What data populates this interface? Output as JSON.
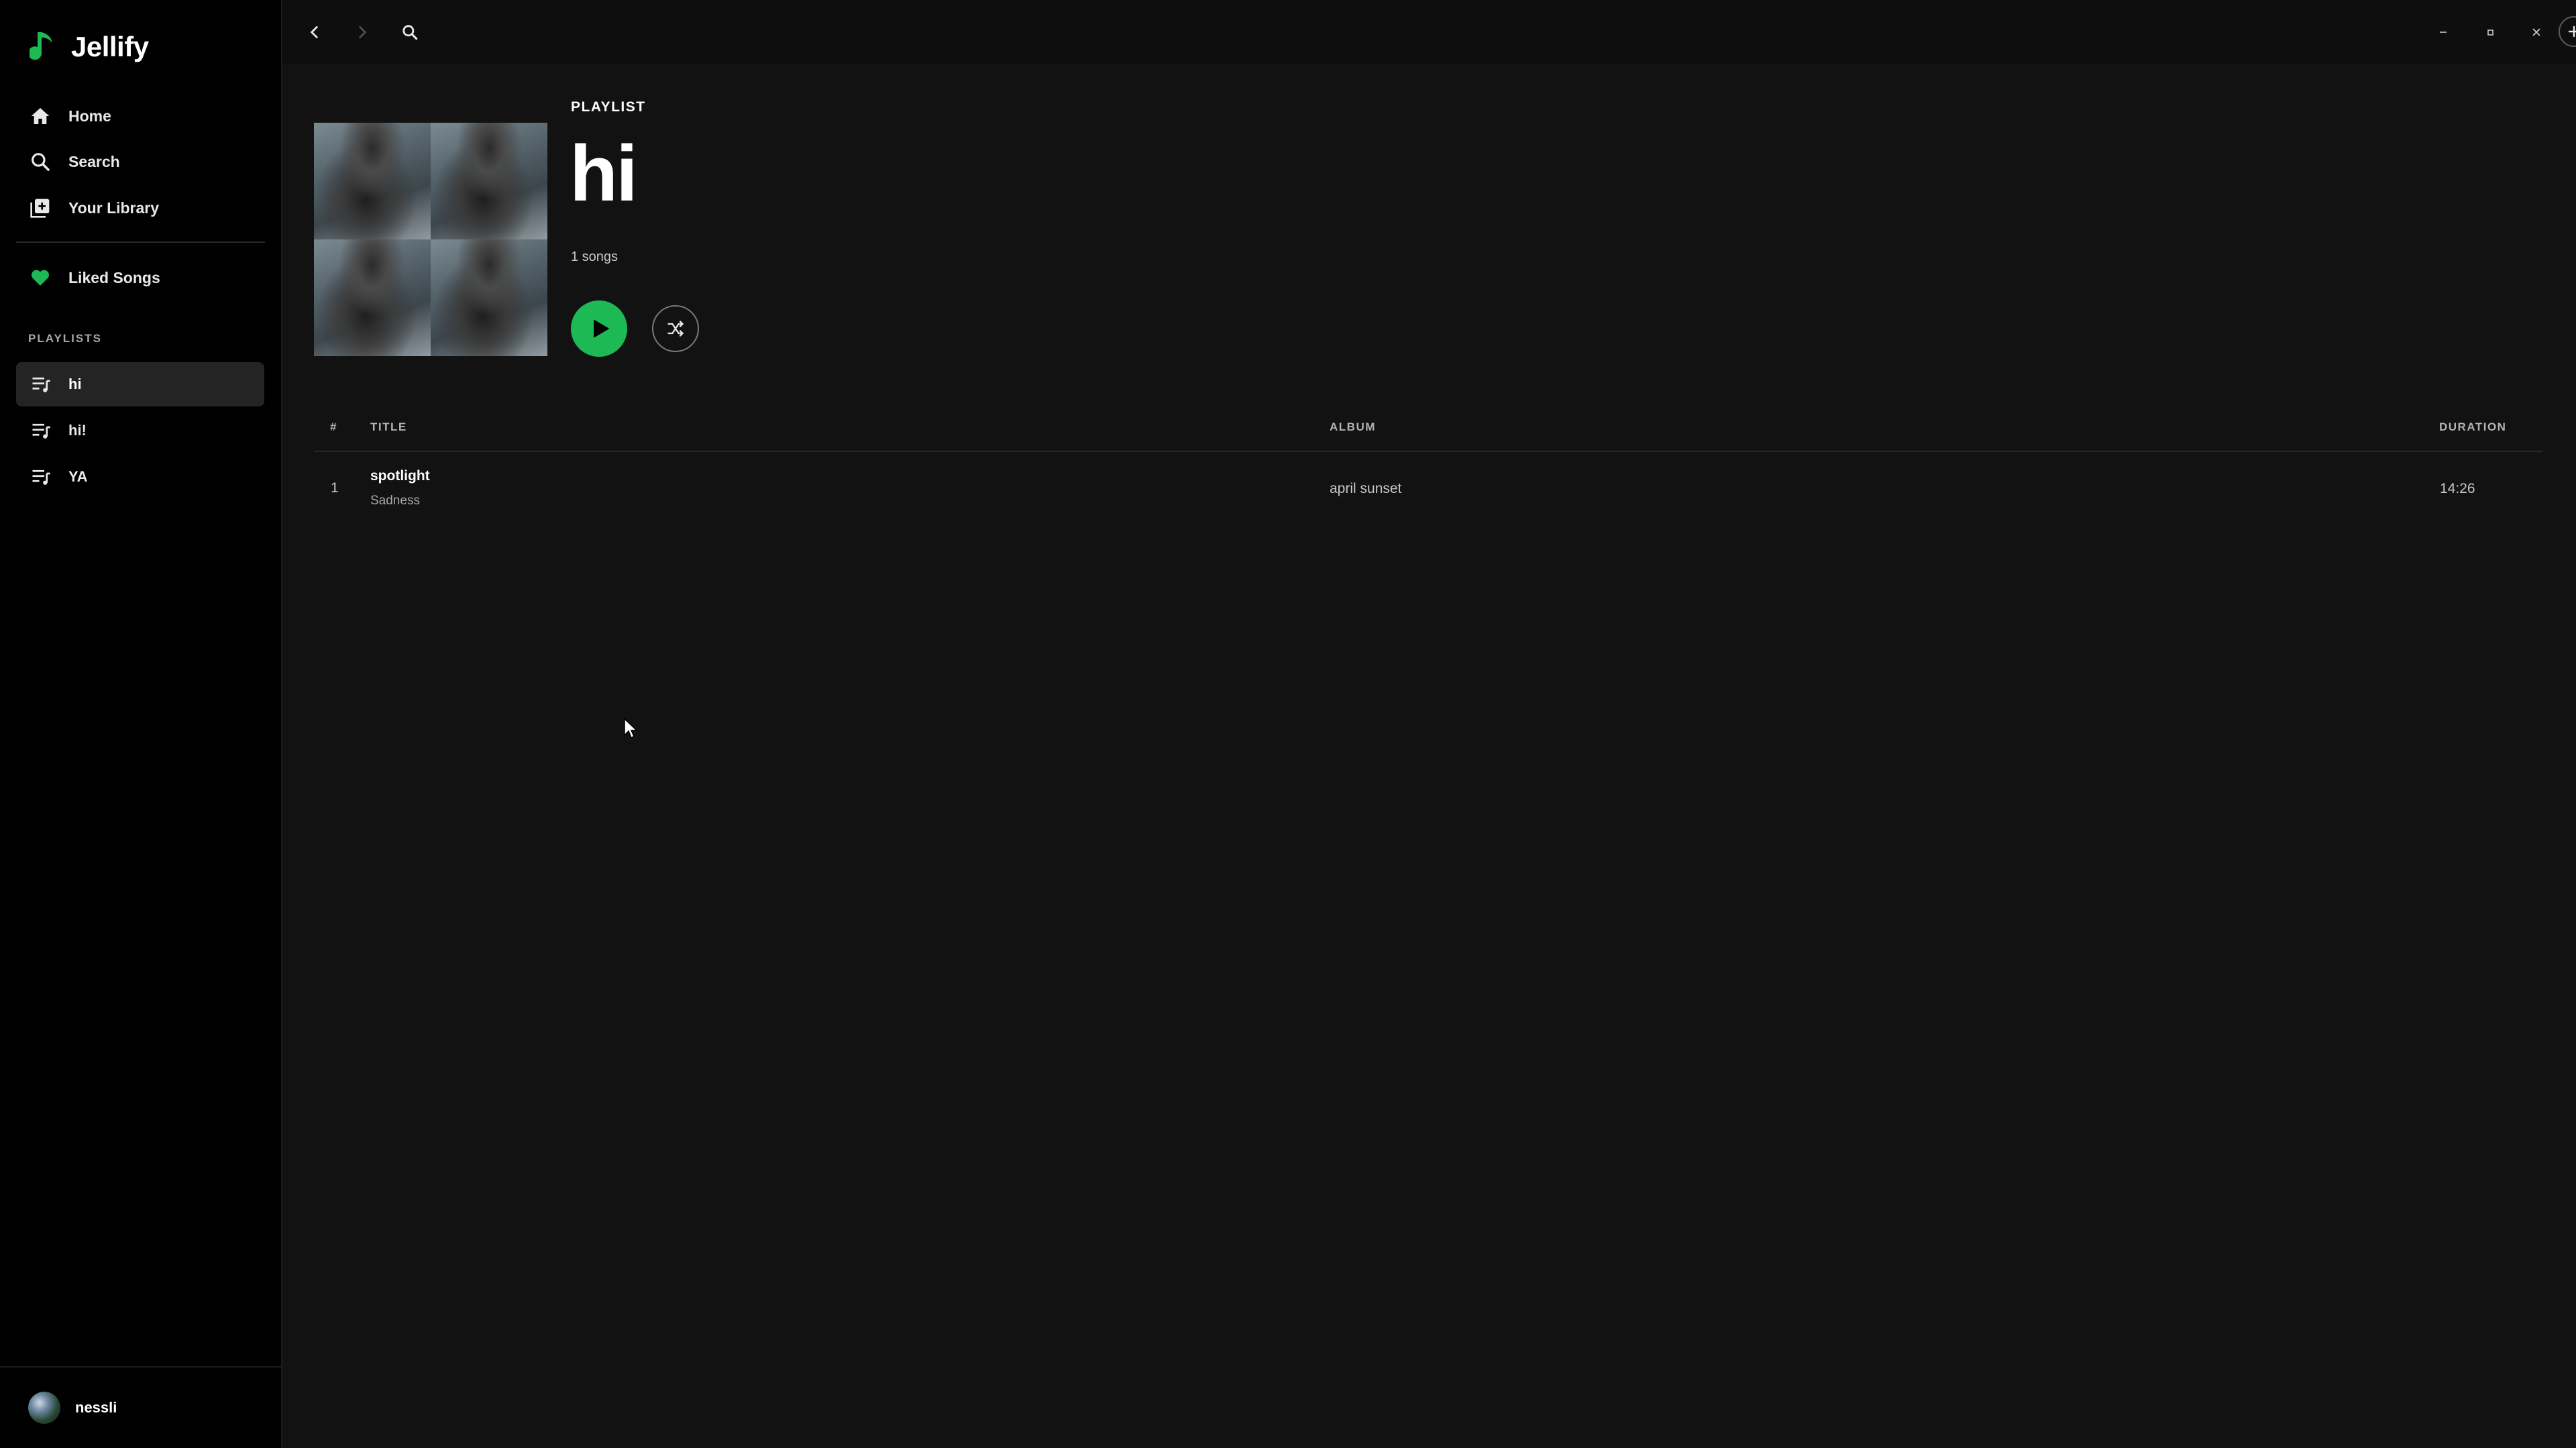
{
  "app": {
    "name": "Jellify"
  },
  "sidebar": {
    "nav": [
      {
        "label": "Home",
        "icon": "home-icon"
      },
      {
        "label": "Search",
        "icon": "search-icon"
      },
      {
        "label": "Your Library",
        "icon": "library-icon"
      }
    ],
    "liked": {
      "label": "Liked Songs",
      "icon": "heart-icon"
    },
    "playlists_label": "PLAYLISTS",
    "playlists": [
      {
        "label": "hi",
        "active": true
      },
      {
        "label": "hi!",
        "active": false
      },
      {
        "label": "YA",
        "active": false
      }
    ],
    "user": {
      "name": "nessli"
    }
  },
  "topbar": {
    "icons": [
      "back-icon",
      "forward-icon",
      "search-icon",
      "add-icon",
      "gear-icon",
      "minimize-icon",
      "maximize-icon",
      "close-icon"
    ]
  },
  "playlist": {
    "type": "PLAYLIST",
    "title": "hi",
    "count": "1 songs"
  },
  "table": {
    "headers": {
      "num": "#",
      "title": "TITLE",
      "album": "ALBUM",
      "duration": "DURATION"
    },
    "rows": [
      {
        "num": "1",
        "title": "spotlight",
        "artist": "Sadness",
        "album": "april sunset",
        "duration": "14:26"
      }
    ]
  },
  "colors": {
    "accent": "#1db954",
    "background": "#121212",
    "sidebar": "#000000"
  }
}
